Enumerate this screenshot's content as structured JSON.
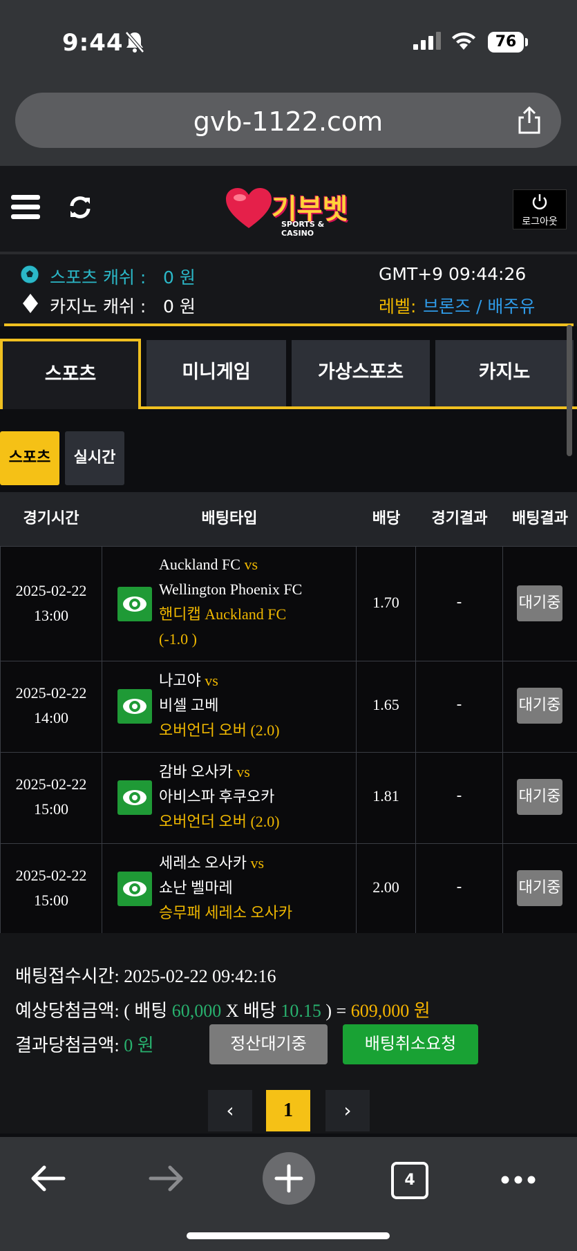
{
  "status": {
    "time": "9:44",
    "battery": "76"
  },
  "browser": {
    "url": "gvb-1122.com",
    "tab_count": "4"
  },
  "header": {
    "logo_text": "기부벳",
    "logo_sub": "SPORTS & CASINO",
    "logout": "로그아웃"
  },
  "info": {
    "sports_cash_label": "스포츠 캐쉬 :",
    "sports_cash_value": "0 원",
    "casino_cash_label": "카지노 캐쉬 :",
    "casino_cash_value": "0 원",
    "clock": "GMT+9 09:44:26",
    "level_label": "레벨:",
    "level_value": "브론즈 / 배주유"
  },
  "tabs": [
    "스포츠",
    "미니게임",
    "가상스포츠",
    "카지노"
  ],
  "subtabs": [
    "스포츠",
    "실시간"
  ],
  "table": {
    "headers": [
      "경기시간",
      "배팅타입",
      "배당",
      "경기결과",
      "배팅결과"
    ],
    "rows": [
      {
        "date": "2025-02-22",
        "time": "13:00",
        "home": "Auckland FC",
        "vs": "vs",
        "away": "Wellington Phoenix FC",
        "pick1": "핸디캡 Auckland FC",
        "pick2": "(-1.0 )",
        "odds": "1.70",
        "result": "-",
        "status": "대기중"
      },
      {
        "date": "2025-02-22",
        "time": "14:00",
        "home": "나고야",
        "vs": "vs",
        "away": "비셀 고베",
        "pick1": "오버언더 오버 (2.0)",
        "pick2": "",
        "odds": "1.65",
        "result": "-",
        "status": "대기중"
      },
      {
        "date": "2025-02-22",
        "time": "15:00",
        "home": "감바 오사카",
        "vs": "vs",
        "away": "아비스파 후쿠오카",
        "pick1": "오버언더 오버 (2.0)",
        "pick2": "",
        "odds": "1.81",
        "result": "-",
        "status": "대기중"
      },
      {
        "date": "2025-02-22",
        "time": "15:00",
        "home": "세레소 오사카",
        "vs": "vs",
        "away": "쇼난 벨마레",
        "pick1": "승무패 세레소 오사카",
        "pick2": "",
        "odds": "2.00",
        "result": "-",
        "status": "대기중"
      }
    ]
  },
  "summary": {
    "received_label": "배팅접수시간:",
    "received_value": "2025-02-22 09:42:16",
    "expected_label": "예상당첨금액:",
    "expected_open": "( 배팅",
    "bet_amount": "60,000",
    "x": "X 배당",
    "total_odds": "10.15",
    "close_eq": ") =",
    "expected_win": "609,000 원",
    "result_label": "결과당첨금액:",
    "result_value": "0 원",
    "settle_button": "정산대기중",
    "cancel_button": "배팅취소요청"
  },
  "pagination": {
    "prev": "‹",
    "current": "1",
    "next": "›"
  },
  "icons": [
    "menu-icon",
    "refresh-icon",
    "power-icon",
    "soccer-ball-icon",
    "diamond-icon",
    "eye-icon",
    "back-arrow-icon",
    "forward-arrow-icon",
    "plus-icon",
    "more-icon",
    "share-icon"
  ]
}
